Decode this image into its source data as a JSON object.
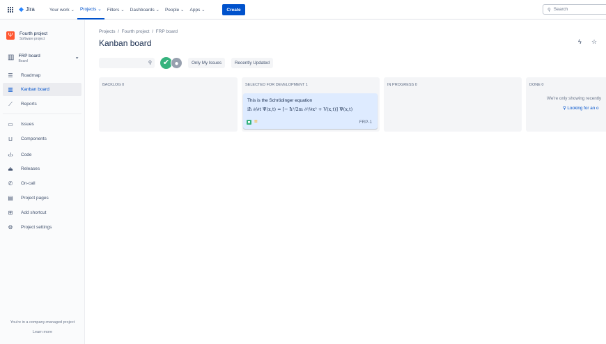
{
  "topnav": {
    "app": "Jira",
    "items": [
      "Your work",
      "Projects",
      "Filters",
      "Dashboards",
      "People",
      "Apps"
    ],
    "active": 1,
    "create": "Create",
    "search_placeholder": "Search"
  },
  "sidebar": {
    "project_name": "Fourth project",
    "project_type": "Software project",
    "board_name": "FRP board",
    "board_type": "Board",
    "items": [
      {
        "label": "Roadmap",
        "icon": "roadmap-icon"
      },
      {
        "label": "Kanban board",
        "icon": "board-icon"
      },
      {
        "label": "Reports",
        "icon": "reports-icon"
      },
      {
        "label": "Issues",
        "icon": "issues-icon"
      },
      {
        "label": "Components",
        "icon": "components-icon"
      },
      {
        "label": "Code",
        "icon": "code-icon"
      },
      {
        "label": "Releases",
        "icon": "releases-icon"
      },
      {
        "label": "On-call",
        "icon": "on-call-icon"
      },
      {
        "label": "Project pages",
        "icon": "pages-icon"
      },
      {
        "label": "Add shortcut",
        "icon": "add-shortcut-icon"
      },
      {
        "label": "Project settings",
        "icon": "settings-icon"
      }
    ],
    "footer": "You're in a company-managed project",
    "learn_more": "Learn more"
  },
  "breadcrumb": [
    "Projects",
    "Fourth project",
    "FRP board"
  ],
  "title": "Kanban board",
  "filters": {
    "only_my": "Only My Issues",
    "recent": "Recently Updated"
  },
  "columns": [
    {
      "name": "BACKLOG 0"
    },
    {
      "name": "SELECTED FOR DEVELOPMENT 1"
    },
    {
      "name": "IN PROGRESS 0"
    },
    {
      "name": "DONE 0"
    }
  ],
  "card": {
    "summary": "This is the Schrödinger equation",
    "equation": "iħ ∂/∂t Ψ(x,t) = [− ħ²/2m ∂²/∂x² + V(x,t)] Ψ(x,t)",
    "key": "FRP-1"
  },
  "done": {
    "msg": "We're only showing recently",
    "link": "Looking for an o"
  }
}
